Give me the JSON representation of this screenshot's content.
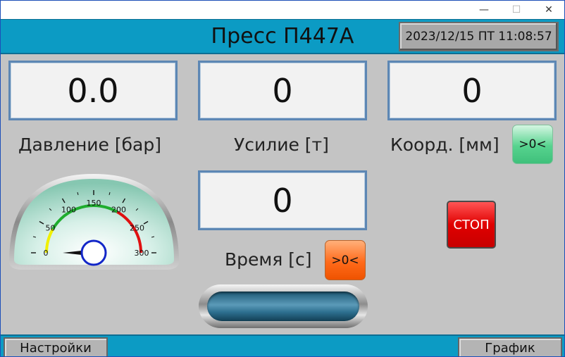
{
  "window": {
    "minimize": "—",
    "maximize": "☐",
    "close": "✕"
  },
  "header": {
    "title": "Пресс П447А",
    "datetime": "2023/12/15 ПТ 11:08:57"
  },
  "pressure": {
    "value": "0.0",
    "label": "Давление [бар]"
  },
  "force": {
    "value": "0",
    "label": "Усилие [т]"
  },
  "coord": {
    "value": "0",
    "label": "Коорд. [мм]",
    "zero_label": ">0<"
  },
  "time": {
    "value": "0",
    "label": "Время [с]",
    "zero_label": ">0<"
  },
  "stop": {
    "label": "СТОП"
  },
  "progress": {
    "fraction": 0
  },
  "gauge": {
    "min": 0,
    "max": 300,
    "value": 0,
    "ticks": [
      "0",
      "50",
      "100",
      "150",
      "200",
      "250",
      "300"
    ],
    "zones": [
      {
        "from": 0,
        "to": 50,
        "color": "#f0f000"
      },
      {
        "from": 50,
        "to": 200,
        "color": "#1fad2e"
      },
      {
        "from": 200,
        "to": 300,
        "color": "#e01010"
      }
    ]
  },
  "footer": {
    "settings": "Настройки",
    "graph": "График"
  }
}
